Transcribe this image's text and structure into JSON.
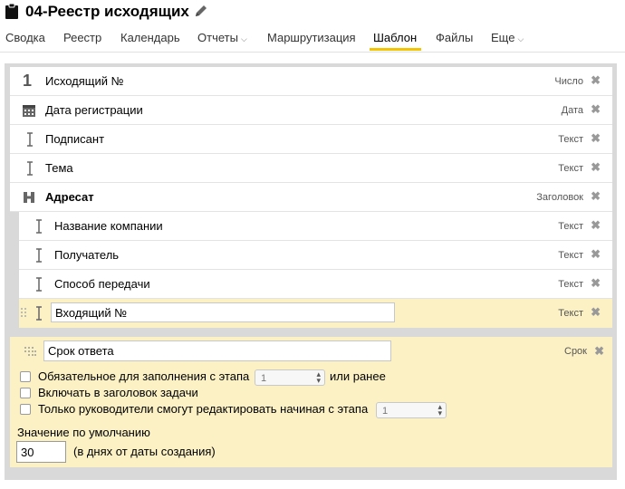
{
  "header": {
    "title": "04-Реестр исходящих",
    "icon": "clipboard-icon",
    "edit_icon": "pencil-icon"
  },
  "tabs": [
    {
      "label": "Сводка"
    },
    {
      "label": "Реестр"
    },
    {
      "label": "Календарь"
    },
    {
      "label": "Отчеты",
      "caret": "⌵"
    },
    {
      "label": "Маршрутизация"
    },
    {
      "label": "Шаблон",
      "active": true
    },
    {
      "label": "Файлы"
    },
    {
      "label": "Еще",
      "caret": "⌵"
    }
  ],
  "fields": [
    {
      "icon": "number-icon",
      "icon_glyph": "1",
      "label": "Исходящий №",
      "type": "Число"
    },
    {
      "icon": "calendar-icon",
      "label": "Дата регистрации",
      "type": "Дата"
    },
    {
      "icon": "text-cursor-icon",
      "label": "Подписант",
      "type": "Текст"
    },
    {
      "icon": "text-cursor-icon",
      "label": "Тема",
      "type": "Текст"
    },
    {
      "icon": "heading-icon",
      "label": "Адресат",
      "type": "Заголовок"
    },
    {
      "icon": "text-cursor-icon",
      "label": "Название компании",
      "type": "Текст"
    },
    {
      "icon": "text-cursor-icon",
      "label": "Получатель",
      "type": "Текст"
    },
    {
      "icon": "text-cursor-icon",
      "label": "Способ передачи",
      "type": "Текст"
    },
    {
      "icon": "text-cursor-icon",
      "label": "Входящий №",
      "type": "Текст",
      "editing": true
    }
  ],
  "delete_glyph": "✖",
  "expanded_field": {
    "name": "Срок ответа",
    "type": "Срок",
    "icon": "deadline-icon",
    "options": {
      "required": {
        "label": "Обязательное для заполнения с этапа",
        "stage": "1",
        "suffix": "или ранее",
        "checked": false
      },
      "in_header": {
        "label": "Включать в заголовок задачи",
        "checked": false
      },
      "managers_only": {
        "label": "Только руководители смогут редактировать начиная с этапа",
        "stage": "1",
        "checked": false
      }
    },
    "default_label": "Значение по умолчанию",
    "default_value": "30",
    "default_hint": "(в днях от даты создания)"
  },
  "colors": {
    "accent": "#f5c400",
    "editing_bg": "#fcf1c5",
    "panel_bg": "#d9d9d9"
  }
}
